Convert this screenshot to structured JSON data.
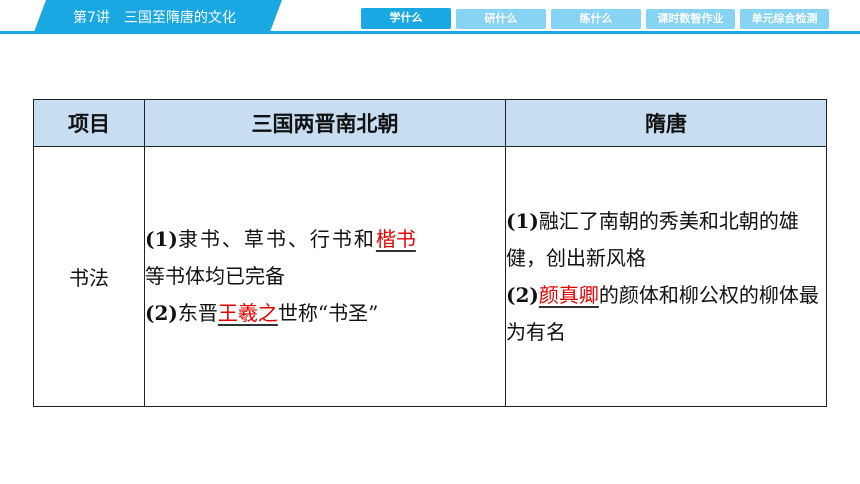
{
  "header": {
    "lesson": "第7讲",
    "title": "三国至隋唐的文化",
    "nav": [
      "学什么",
      "研什么",
      "练什么",
      "课时数智作业",
      "单元综合检测"
    ]
  },
  "table": {
    "headers": [
      "项目",
      "三国两晋南北朝",
      "隋唐"
    ],
    "row": {
      "item": "书法",
      "col2": {
        "p1_num": "(1)",
        "p1_text": "隶书、草书、行书和",
        "p1_answer": "楷书",
        "p1_line2": "等书体均已完备",
        "p2_num": "(2)",
        "p2_text": "东晋",
        "p2_answer": "王羲之",
        "p2_tail": "世称“书圣”"
      },
      "col3": {
        "p1_num": "(1)",
        "p1_text": "融汇了南朝的秀美和北朝的雄健，创出新风格",
        "p2_num": "(2)",
        "p2_answer": "颜真卿",
        "p2_tail": "的颜体和柳公权的柳体最为有名"
      }
    }
  },
  "colors": {
    "accent": "#19a8e2",
    "tab_inactive": "#86d3f3",
    "header_bg": "#c6ddf2",
    "answer": "#e30000"
  }
}
